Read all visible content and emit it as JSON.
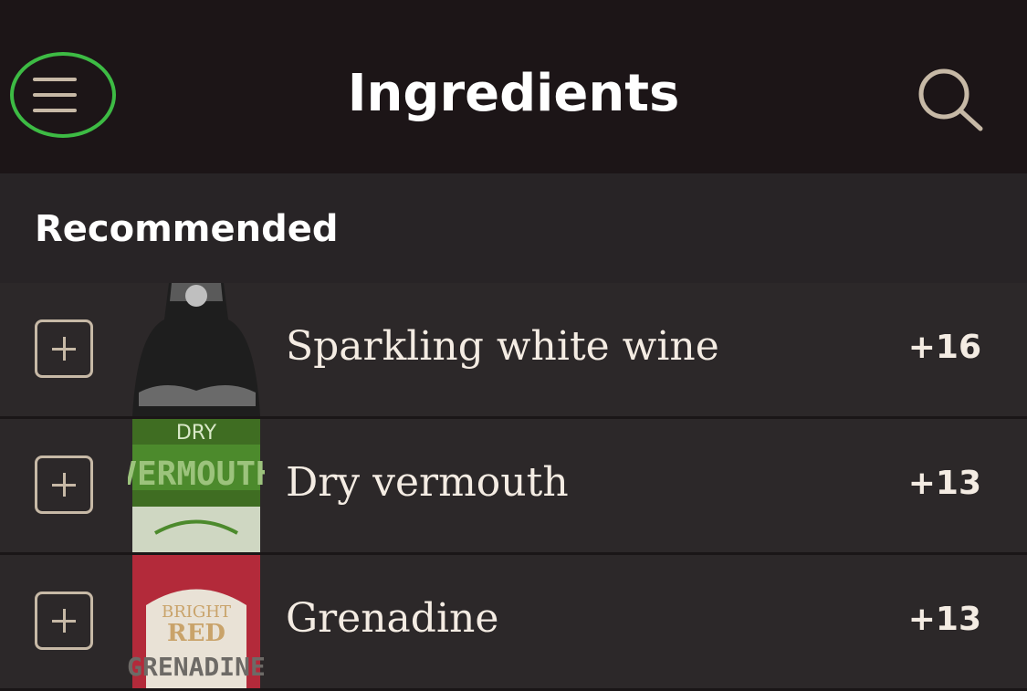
{
  "header": {
    "title": "Ingredients",
    "menu_icon": "hamburger-menu-icon",
    "search_icon": "search-icon"
  },
  "section": {
    "title": "Recommended"
  },
  "items": [
    {
      "name": "Sparkling white wine",
      "count": "+16",
      "thumb_color": "#2a2a2a"
    },
    {
      "name": "Dry vermouth",
      "count": "+13",
      "thumb_color": "#4a7a2a",
      "label_lines": [
        "DRY",
        "VERMOUTH"
      ]
    },
    {
      "name": "Grenadine",
      "count": "+13",
      "thumb_color": "#b83040",
      "label_lines": [
        "BRIGHT",
        "RED",
        "GRENADINE"
      ]
    }
  ],
  "colors": {
    "accent_highlight": "#3dbb44",
    "icon": "#c7b9a6"
  }
}
